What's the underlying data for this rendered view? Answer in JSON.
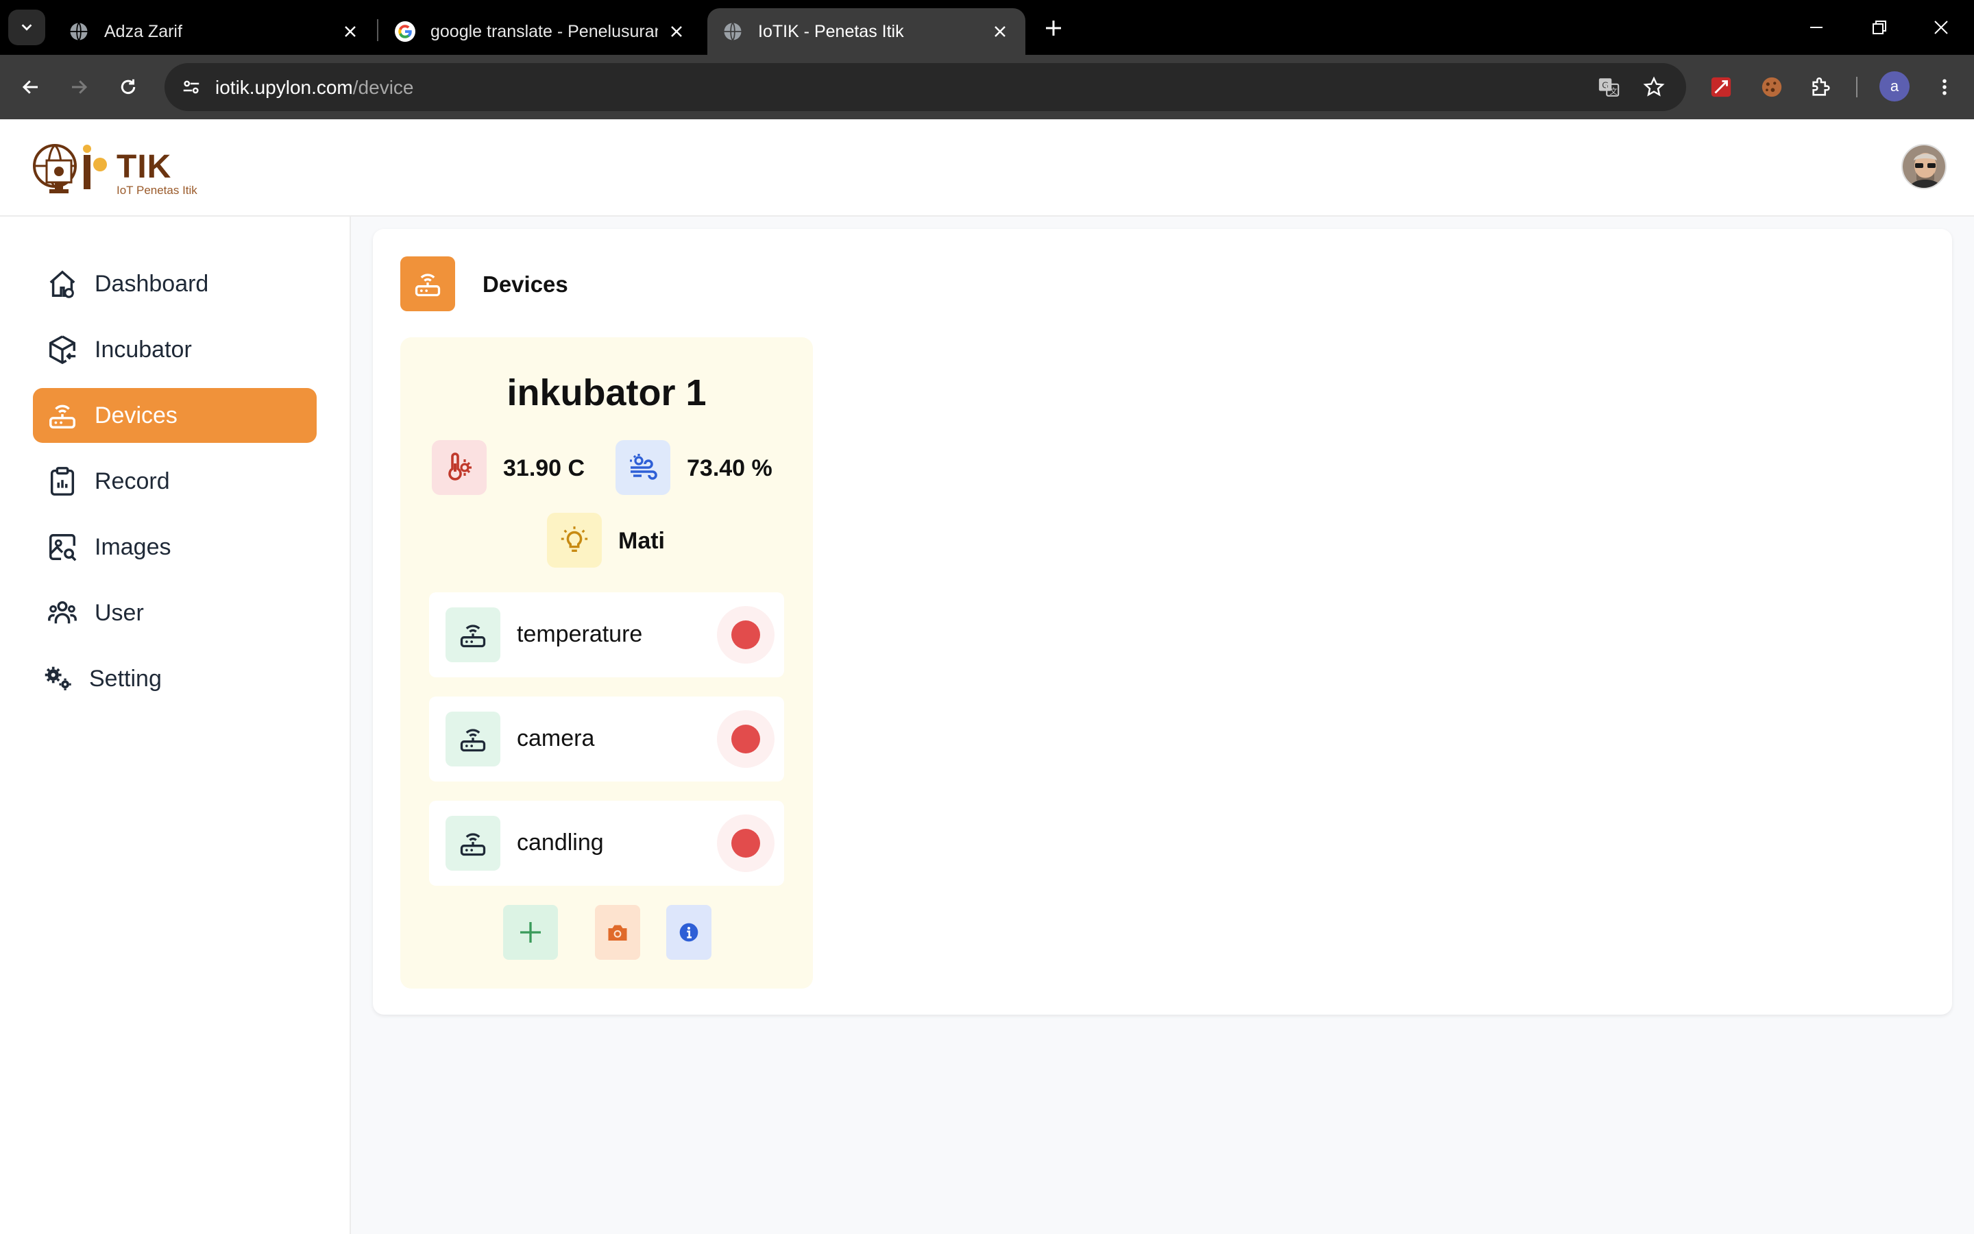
{
  "browser": {
    "tabs": [
      {
        "title": "Adza Zarif"
      },
      {
        "title": "google translate - Penelusuran G"
      },
      {
        "title": "IoTIK - Penetas Itik"
      }
    ],
    "url": {
      "host": "iotik.upylon.com",
      "path": "/device"
    },
    "profile_initial": "a"
  },
  "header": {
    "logo_text": "TIK",
    "logo_subtitle": "IoT Penetas Itik"
  },
  "sidebar": {
    "items": [
      {
        "label": "Dashboard",
        "icon": "home-icon"
      },
      {
        "label": "Incubator",
        "icon": "box-icon"
      },
      {
        "label": "Devices",
        "icon": "router-icon",
        "active": true
      },
      {
        "label": "Record",
        "icon": "clipboard-icon"
      },
      {
        "label": "Images",
        "icon": "image-search-icon"
      },
      {
        "label": "User",
        "icon": "users-icon"
      },
      {
        "label": "Setting",
        "icon": "gears-icon"
      }
    ]
  },
  "page": {
    "title": "Devices"
  },
  "device": {
    "name": "inkubator 1",
    "temperature": "31.90 C",
    "humidity": "73.40 %",
    "lamp_status": "Mati",
    "sensors": [
      {
        "label": "temperature",
        "status": "offline"
      },
      {
        "label": "camera",
        "status": "offline"
      },
      {
        "label": "candling",
        "status": "offline"
      }
    ]
  },
  "colors": {
    "accent": "#f0923a",
    "status_offline": "#e24c4c",
    "card_bg": "#fefbea"
  }
}
